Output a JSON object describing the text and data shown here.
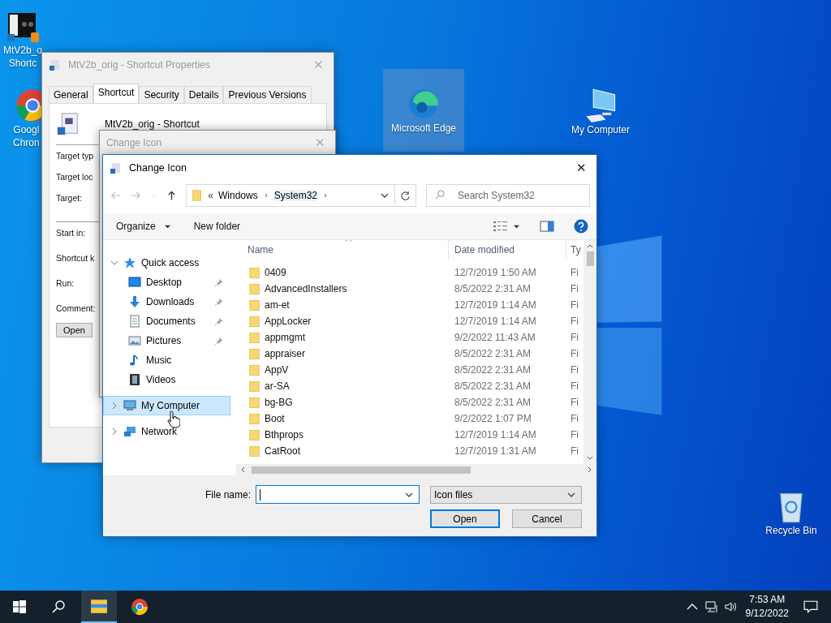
{
  "desktop_icons": [
    {
      "label": "MtV2b_o\nShortc",
      "kind": "video",
      "selected": false
    },
    {
      "label": "Googl\nChron",
      "kind": "chrome",
      "selected": false
    },
    {
      "label": "Microsoft Edge",
      "kind": "edge",
      "selected": true
    },
    {
      "label": "My Computer",
      "kind": "computer",
      "selected": false
    },
    {
      "label": "Recycle Bin",
      "kind": "recycle",
      "selected": false
    }
  ],
  "properties_window": {
    "title": "MtV2b_orig - Shortcut Properties",
    "tabs": [
      {
        "label": "General",
        "selected": false
      },
      {
        "label": "Shortcut",
        "selected": true
      },
      {
        "label": "Security",
        "selected": false
      },
      {
        "label": "Details",
        "selected": false
      },
      {
        "label": "Previous Versions",
        "selected": false
      }
    ],
    "file_name": "MtV2b_orig - Shortcut",
    "fields_top": [
      "Target typ",
      "Target loc",
      "Target:"
    ],
    "fields_bottom": [
      "Start in:",
      "Shortcut k",
      "Run:",
      "Comment:"
    ],
    "button": "Open",
    "close": "✕"
  },
  "change_icon_window": {
    "title": "Change Icon",
    "close": "✕"
  },
  "file_dialog": {
    "title": "Change Icon",
    "close": "✕",
    "overflow": "«",
    "breadcrumb": [
      "Windows",
      "System32"
    ],
    "search": {
      "placeholder": "Search System32"
    },
    "toolbar": {
      "organize": "Organize",
      "new_folder": "New folder"
    },
    "nav": [
      {
        "label": "Quick access",
        "kind": "star",
        "expanded": true,
        "selected": false,
        "children": [
          {
            "label": "Desktop",
            "kind": "desktop",
            "pinned": true,
            "selected": false
          },
          {
            "label": "Downloads",
            "kind": "downloads",
            "pinned": true,
            "selected": false
          },
          {
            "label": "Documents",
            "kind": "documents",
            "pinned": true,
            "selected": false
          },
          {
            "label": "Pictures",
            "kind": "pictures",
            "pinned": true,
            "selected": false
          },
          {
            "label": "Music",
            "kind": "music",
            "pinned": false,
            "selected": false
          },
          {
            "label": "Videos",
            "kind": "videos",
            "pinned": false,
            "selected": false
          }
        ]
      },
      {
        "label": "My Computer",
        "kind": "computer",
        "expanded": false,
        "selected": true
      },
      {
        "label": "Network",
        "kind": "network",
        "expanded": false,
        "selected": false
      }
    ],
    "columns": [
      "Name",
      "Date modified",
      "Ty"
    ],
    "rows": [
      {
        "name": "0409",
        "date": "12/7/2019 1:50 AM",
        "type": "Fi"
      },
      {
        "name": "AdvancedInstallers",
        "date": "8/5/2022 2:31 AM",
        "type": "Fi"
      },
      {
        "name": "am-et",
        "date": "12/7/2019 1:14 AM",
        "type": "Fi"
      },
      {
        "name": "AppLocker",
        "date": "12/7/2019 1:14 AM",
        "type": "Fi"
      },
      {
        "name": "appmgmt",
        "date": "9/2/2022 11:43 AM",
        "type": "Fi"
      },
      {
        "name": "appraiser",
        "date": "8/5/2022 2:31 AM",
        "type": "Fi"
      },
      {
        "name": "AppV",
        "date": "8/5/2022 2:31 AM",
        "type": "Fi"
      },
      {
        "name": "ar-SA",
        "date": "8/5/2022 2:31 AM",
        "type": "Fi"
      },
      {
        "name": "bg-BG",
        "date": "8/5/2022 2:31 AM",
        "type": "Fi"
      },
      {
        "name": "Boot",
        "date": "9/2/2022 1:07 PM",
        "type": "Fi"
      },
      {
        "name": "Bthprops",
        "date": "12/7/2019 1:14 AM",
        "type": "Fi"
      },
      {
        "name": "CatRoot",
        "date": "12/7/2019 1:31 AM",
        "type": "Fi"
      }
    ],
    "file_name_label": "File name:",
    "filter": "Icon files",
    "buttons": [
      "Open",
      "Cancel"
    ]
  },
  "taskbar": {
    "time": "7:53 AM",
    "date": "9/12/2022"
  }
}
